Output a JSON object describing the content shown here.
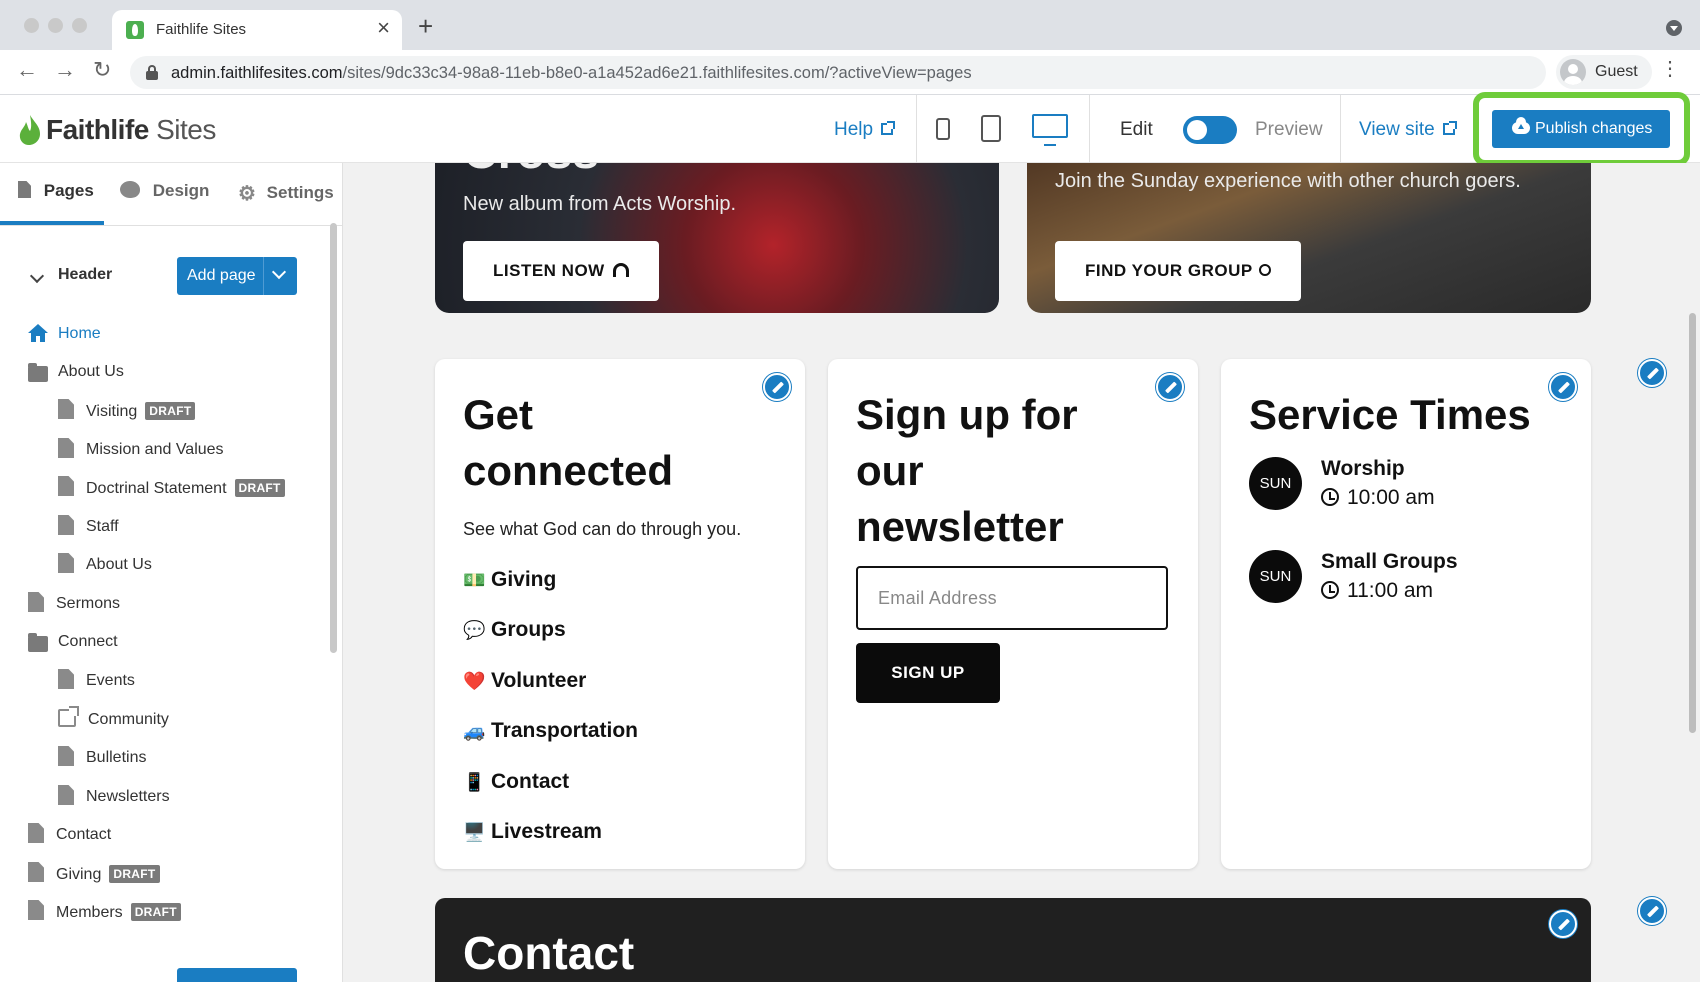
{
  "browser": {
    "tab_title": "Faithlife Sites",
    "url_host": "admin.faithlifesites.com",
    "url_path": "/sites/9dc33c34-98a8-11eb-b8e0-a1a452ad6e21.faithlifesites.com/?activeView=pages",
    "profile_label": "Guest"
  },
  "app": {
    "logo_bold": "Faithlife",
    "logo_light": "Sites",
    "help_label": "Help",
    "edit_label": "Edit",
    "preview_label": "Preview",
    "view_site_label": "View site",
    "publish_label": "Publish changes",
    "accent_color": "#1a7dc2",
    "highlight_color": "#6fcc3a"
  },
  "sidebar": {
    "tabs": [
      {
        "label": "Pages",
        "icon": "page-icon",
        "active": true
      },
      {
        "label": "Design",
        "icon": "palette-icon",
        "active": false
      },
      {
        "label": "Settings",
        "icon": "gear-icon",
        "active": false
      }
    ],
    "section_label": "Header",
    "add_page_label": "Add page",
    "draft_badge": "DRAFT",
    "pages": [
      {
        "label": "Home",
        "icon": "home-icon"
      },
      {
        "label": "About Us",
        "icon": "folder-icon"
      },
      {
        "label": "Visiting",
        "icon": "page-icon",
        "draft": true
      },
      {
        "label": "Mission and Values",
        "icon": "page-icon"
      },
      {
        "label": "Doctrinal Statement",
        "icon": "page-icon",
        "draft": true
      },
      {
        "label": "Staff",
        "icon": "page-icon"
      },
      {
        "label": "About Us",
        "icon": "page-icon"
      },
      {
        "label": "Sermons",
        "icon": "page-icon"
      },
      {
        "label": "Connect",
        "icon": "folder-icon"
      },
      {
        "label": "Events",
        "icon": "page-icon"
      },
      {
        "label": "Community",
        "icon": "external-link-icon"
      },
      {
        "label": "Bulletins",
        "icon": "page-icon"
      },
      {
        "label": "Newsletters",
        "icon": "page-icon"
      },
      {
        "label": "Contact",
        "icon": "page-icon"
      },
      {
        "label": "Giving",
        "icon": "page-icon",
        "draft": true
      },
      {
        "label": "Members",
        "icon": "page-icon",
        "draft": true
      }
    ]
  },
  "canvas": {
    "hero_left": {
      "title": "Cross",
      "subtitle": "New album from Acts Worship.",
      "button_label": "LISTEN NOW"
    },
    "hero_right": {
      "subtitle": "Join the Sunday experience with other church goers.",
      "button_label": "FIND YOUR GROUP"
    },
    "get_connected": {
      "title_line1": "Get",
      "title_line2": "connected",
      "body": "See what God can do through you.",
      "links": [
        {
          "emoji": "💵",
          "label": "Giving"
        },
        {
          "emoji": "💬",
          "label": "Groups"
        },
        {
          "emoji": "❤️",
          "label": "Volunteer"
        },
        {
          "emoji": "🚙",
          "label": "Transportation"
        },
        {
          "emoji": "📱",
          "label": "Contact"
        },
        {
          "emoji": "🖥️",
          "label": "Livestream"
        }
      ]
    },
    "newsletter": {
      "title_line1": "Sign up for",
      "title_line2": "our",
      "title_line3": "newsletter",
      "email_placeholder": "Email Address",
      "button_label": "SIGN UP"
    },
    "service_times": {
      "title": "Service Times",
      "services": [
        {
          "day": "SUN",
          "name": "Worship",
          "time": "10:00 am"
        },
        {
          "day": "SUN",
          "name": "Small Groups",
          "time": "11:00 am"
        }
      ]
    },
    "contact": {
      "title": "Contact"
    }
  }
}
